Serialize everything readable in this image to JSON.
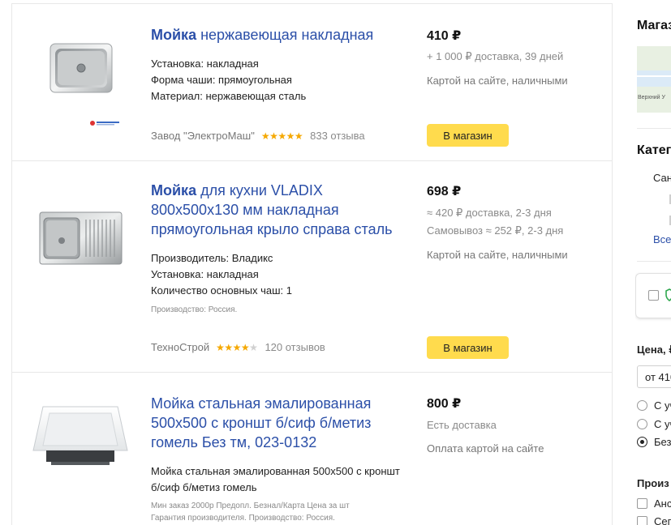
{
  "results": [
    {
      "title_bold": "Мойка",
      "title_rest": " нержавеющая накладная",
      "specs": [
        "Установка: накладная",
        "Форма чаши: прямоугольная",
        "Материал: нержавеющая сталь"
      ],
      "shop": "Завод \"ЭлектроМаш\"",
      "rating": 5,
      "reviews": "833 отзыва",
      "price": "410 ₽",
      "delivery": [
        "+ 1 000 ₽ доставка, 39 дней"
      ],
      "payment": "Картой на сайте, наличными",
      "button": "В магазин",
      "image": "stainless-sink-icon"
    },
    {
      "title_bold": "Мойка",
      "title_rest": " для кухни VLADIX 800х500х130 мм накладная прямоугольная крыло справа сталь",
      "specs": [
        "Производитель: Владикс",
        "Установка: накладная",
        "Количество основных чаш: 1"
      ],
      "note": "Производство: Россия.",
      "shop": "ТехноСтрой",
      "rating": 4,
      "reviews": "120 отзывов",
      "price": "698 ₽",
      "delivery": [
        "≈ 420 ₽ доставка, 2-3 дня",
        "Самовывоз ≈ 252 ₽, 2-3 дня"
      ],
      "payment": "Картой на сайте, наличными",
      "button": "В магазин",
      "image": "sink-with-drainboard-icon"
    },
    {
      "title": "Мойка стальная эмалированная 500х500 с кроншт б/сиф б/метиз гомель Без тм, 023-0132",
      "description": "Мойка стальная эмалированная 500х500 с кроншт б/сиф б/метиз гомель",
      "notes": [
        "Мин заказ 2000р Предопл. Безнал/Карта Цена за шт",
        "Гарантия производителя. Производство: Россия."
      ],
      "price": "800 ₽",
      "delivery": [
        "Есть доставка"
      ],
      "payment": "Оплата картой на сайте",
      "image": "enamel-sink-icon"
    }
  ],
  "sidebar": {
    "map_heading": "Магаз",
    "map_label": "Верхний У",
    "category_heading": "Катег",
    "category_item": "Сан",
    "all_link": "Все",
    "price_heading": "Цена, ₽",
    "price_from": "от 410",
    "radio_options": [
      "С уч",
      "С уч",
      "Без"
    ],
    "radio_selected": 2,
    "maker_heading": "Произ",
    "makers": [
      "Aнс",
      "Сег"
    ]
  },
  "colors": {
    "link": "#2b4fa8",
    "button": "#ffdb4d",
    "star": "#f5a800"
  }
}
